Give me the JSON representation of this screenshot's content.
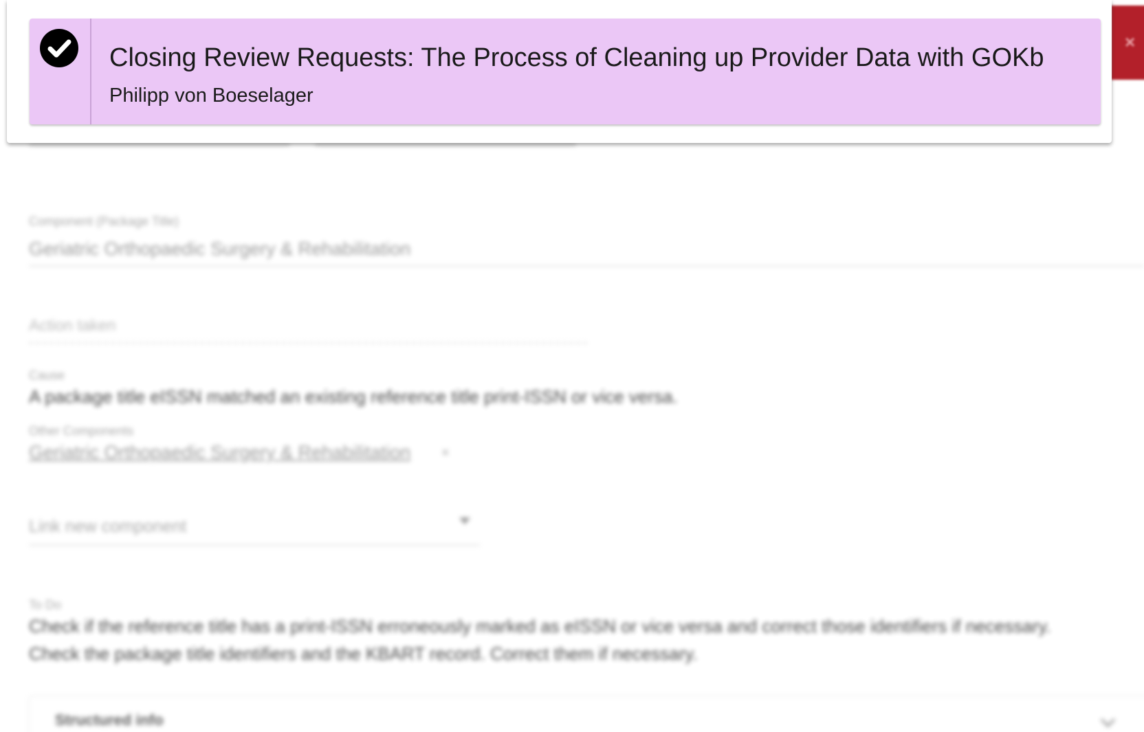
{
  "notification": {
    "title": "Closing Review Requests: The Process of Cleaning up Provider Data with GOKb",
    "author": "Philipp von Boeselager",
    "icon": "check-circle-icon",
    "background": "#ebc7f6"
  },
  "close_button": {
    "icon": "close-icon",
    "label": "×",
    "color": "#b3202a"
  },
  "form": {
    "component": {
      "label": "Component (Package Title)",
      "value": "Geriatric Orthopaedic Surgery & Rehabilitation"
    },
    "action_taken": {
      "label": "Action taken"
    },
    "cause": {
      "label": "Cause",
      "value": "A package title eISSN matched an existing reference title print-ISSN or vice versa."
    },
    "other_components": {
      "label": "Other Components",
      "value": "Geriatric Orthopaedic Surgery & Rehabilitation",
      "remove_label": "×"
    },
    "link_component": {
      "placeholder": "Link new component"
    },
    "todo": {
      "label": "To Do",
      "line1": "Check if the reference title has a print-ISSN erroneously marked as eISSN or vice versa and correct those identifiers if necessary.",
      "line2": "Check the package title identifiers and the KBART record. Correct them if necessary."
    },
    "structured_info": {
      "label": "Structured info"
    }
  }
}
